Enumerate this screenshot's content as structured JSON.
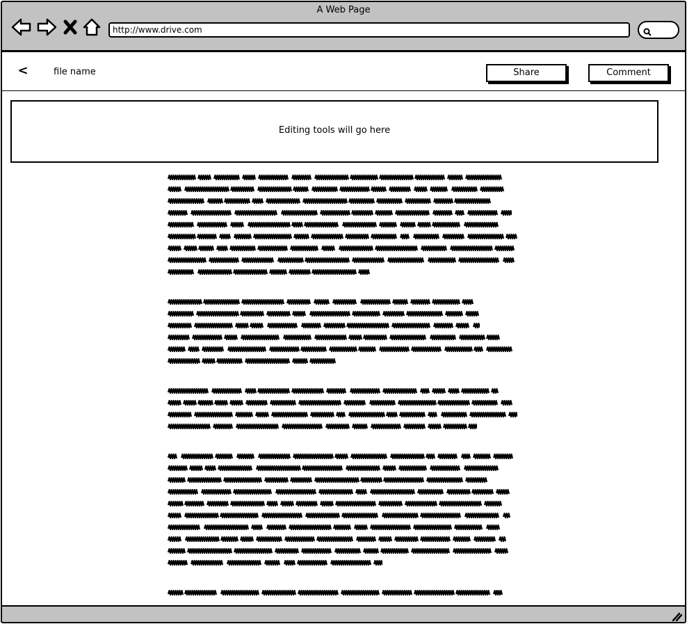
{
  "browser": {
    "title": "A Web Page",
    "url": "http://www.drive.com"
  },
  "header": {
    "back_label": "<",
    "file_name": "file name",
    "share_label": "Share",
    "comment_label": "Comment"
  },
  "editor": {
    "tools_placeholder": "Editing tools will go here"
  },
  "document": {
    "paragraphs": [
      {
        "line_widths": [
          482,
          486,
          468,
          496,
          478,
          504,
          500,
          500,
          302
        ]
      },
      {
        "line_widths": [
          450,
          450,
          450,
          480,
          500,
          244
        ]
      },
      {
        "line_widths": [
          478,
          498,
          504,
          446
        ]
      },
      {
        "line_widths": [
          498,
          478,
          462,
          494,
          494,
          494,
          490,
          488,
          494,
          310
        ]
      },
      {
        "line_widths": [
          484
        ]
      }
    ]
  },
  "colors": {
    "chrome": "#c2c2c2",
    "ink": "#000000"
  }
}
